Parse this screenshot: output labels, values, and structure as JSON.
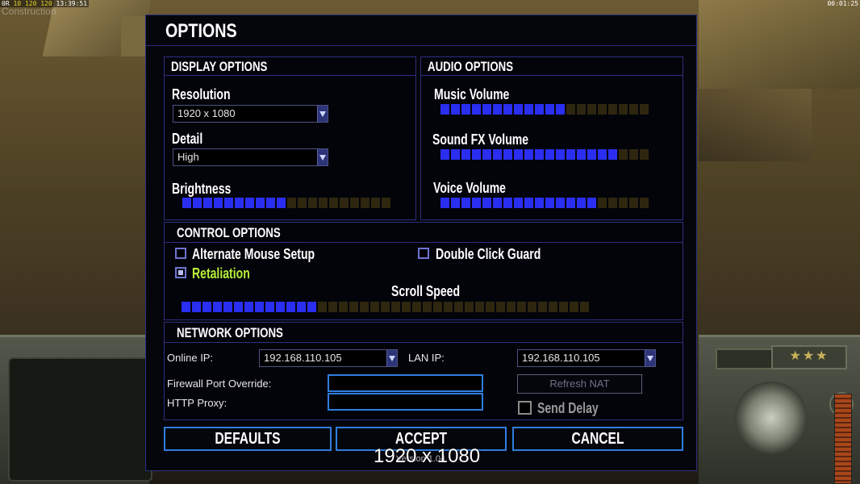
{
  "status": {
    "left_prefix": "0R",
    "left_values": [
      "10",
      "120",
      "120"
    ],
    "left_time": "13:39:51",
    "watermark": "Construction",
    "right_time": "00:01:25"
  },
  "dialog": {
    "title": "OPTIONS",
    "display": {
      "title": "DISPLAY OPTIONS",
      "resolution_label": "Resolution",
      "resolution_value": "1920 x 1080",
      "detail_label": "Detail",
      "detail_value": "High",
      "brightness_label": "Brightness",
      "brightness_level": 0.5
    },
    "audio": {
      "title": "AUDIO OPTIONS",
      "music_label": "Music Volume",
      "music_level": 0.6,
      "sfx_label": "Sound FX Volume",
      "sfx_level": 0.85,
      "voice_label": "Voice Volume",
      "voice_level": 0.75
    },
    "control": {
      "title": "CONTROL OPTIONS",
      "alt_mouse_label": "Alternate Mouse Setup",
      "alt_mouse_checked": false,
      "double_click_label": "Double Click Guard",
      "double_click_checked": false,
      "retaliation_label": "Retaliation",
      "retaliation_checked": true,
      "scroll_label": "Scroll Speed",
      "scroll_level": 0.33
    },
    "network": {
      "title": "NETWORK OPTIONS",
      "online_ip_label": "Online IP:",
      "online_ip_value": "192.168.110.105",
      "lan_ip_label": "LAN IP:",
      "lan_ip_value": "192.168.110.105",
      "firewall_label": "Firewall Port Override:",
      "firewall_value": "",
      "proxy_label": "HTTP Proxy:",
      "proxy_value": "",
      "refresh_nat_label": "Refresh NAT",
      "send_delay_label": "Send Delay",
      "send_delay_checked": false
    },
    "buttons": {
      "defaults": "DEFAULTS",
      "accept": "ACCEPT",
      "cancel": "CANCEL"
    },
    "version": "Version 1.04"
  },
  "overlay_resolution": "1920 x 1080",
  "colors": {
    "accent_blue": "#2a2ef0",
    "border_blue": "#2b2f80",
    "button_border": "#2f7de0",
    "retaliation_green": "#b7f037"
  }
}
